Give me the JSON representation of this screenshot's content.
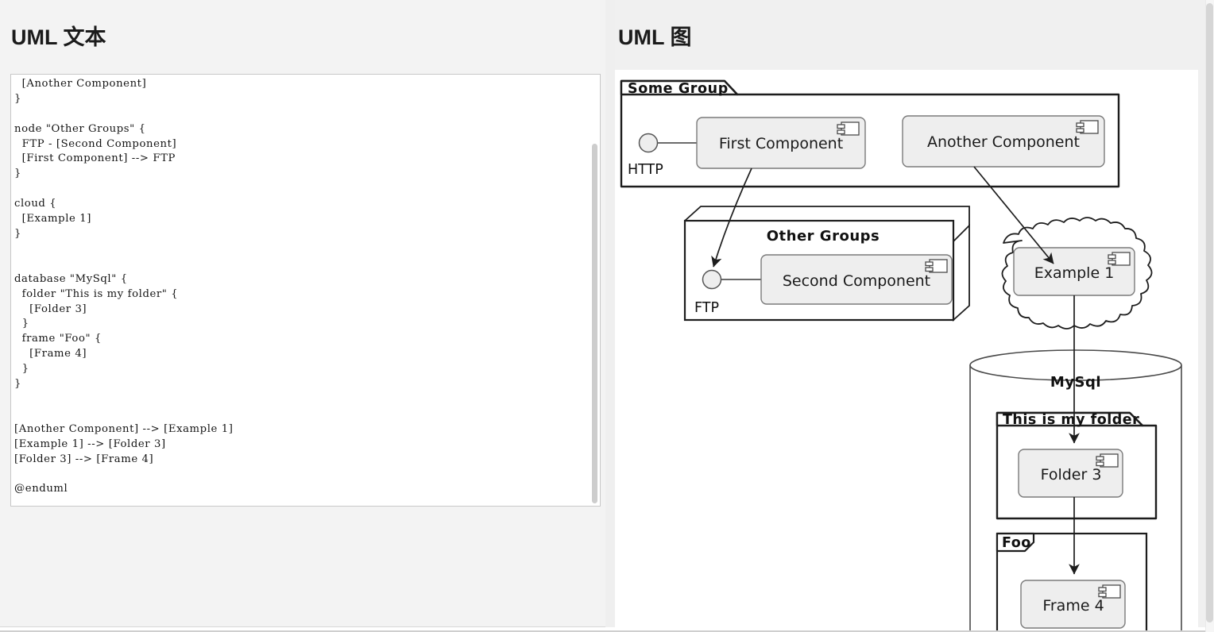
{
  "left": {
    "title": "UML 文本",
    "editor": {
      "name": "uml-source-editor",
      "code": "  HTTP - [First Component]\n  [Another Component]\n}\n\nnode \"Other Groups\" {\n  FTP - [Second Component]\n  [First Component] --> FTP\n}\n\ncloud {\n  [Example 1]\n}\n\n\ndatabase \"MySql\" {\n  folder \"This is my folder\" {\n    [Folder 3]\n  }\n  frame \"Foo\" {\n    [Frame 4]\n  }\n}\n\n\n[Another Component] --> [Example 1]\n[Example 1] --> [Folder 3]\n[Folder 3] --> [Frame 4]\n\n@enduml"
    }
  },
  "right": {
    "title": "UML 图"
  },
  "diagram": {
    "type": "uml-component-diagram",
    "package_some_group": "Some Group",
    "component_first": "First Component",
    "component_another": "Another Component",
    "interface_http": "HTTP",
    "node_other_groups": "Other Groups",
    "component_second": "Second Component",
    "interface_ftp": "FTP",
    "cloud_component_example1": "Example 1",
    "database_mysql": "MySql",
    "folder_title": "This is my folder",
    "component_folder3": "Folder 3",
    "frame_title": "Foo",
    "component_frame4": "Frame 4",
    "edges": [
      {
        "from": "First Component",
        "to": "FTP"
      },
      {
        "from": "Another Component",
        "to": "Example 1"
      },
      {
        "from": "Example 1",
        "to": "Folder 3"
      },
      {
        "from": "Folder 3",
        "to": "Frame 4"
      }
    ],
    "colors": {
      "component_fill": "#eeeeee",
      "stroke": "#1d1d1d",
      "surface": "#ffffff"
    }
  }
}
